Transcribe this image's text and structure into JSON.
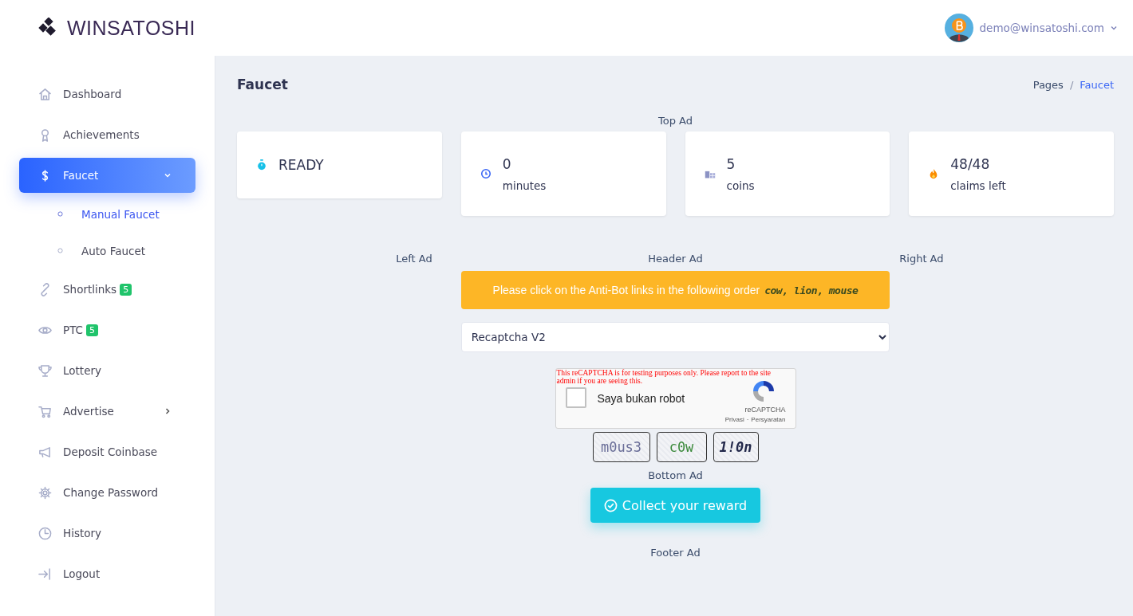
{
  "brand": {
    "name": "WINSATOSHI"
  },
  "user": {
    "email": "demo@winsatoshi.com"
  },
  "sidebar": {
    "items": [
      {
        "label": "Dashboard",
        "selected": false
      },
      {
        "label": "Achievements",
        "selected": false
      },
      {
        "label": "Faucet",
        "selected": true,
        "expanded": true,
        "children": [
          {
            "label": "Manual Faucet",
            "selected": true
          },
          {
            "label": "Auto Faucet",
            "selected": false
          }
        ]
      },
      {
        "label": "Shortlinks",
        "selected": false,
        "badge": "5"
      },
      {
        "label": "PTC",
        "selected": false,
        "badge": "5"
      },
      {
        "label": "Lottery",
        "selected": false
      },
      {
        "label": "Advertise",
        "selected": false,
        "expanded": false
      },
      {
        "label": "Deposit Coinbase",
        "selected": false
      },
      {
        "label": "Change Password",
        "selected": false
      },
      {
        "label": "History",
        "selected": false
      },
      {
        "label": "Logout",
        "selected": false
      }
    ]
  },
  "page": {
    "title": "Faucet",
    "breadcrumb_separator": "/",
    "breadcrumb": [
      {
        "label": "Pages",
        "selected": false
      },
      {
        "label": "Faucet",
        "selected": true
      }
    ]
  },
  "ads": {
    "top": "Top Ad",
    "left": "Left Ad",
    "header": "Header Ad",
    "right": "Right Ad",
    "bottom": "Bottom Ad",
    "footer": "Footer Ad"
  },
  "stats": [
    {
      "value": "READY"
    },
    {
      "value": "0",
      "caption": "minutes"
    },
    {
      "value": "5",
      "caption": "coins"
    },
    {
      "value": "48/48",
      "caption": "claims left"
    }
  ],
  "antibot": {
    "message": "Please click on the Anti-Bot links in the following order",
    "order": "cow, lion, mouse",
    "links": [
      "m0us3",
      "c0w",
      "1!0n"
    ]
  },
  "captcha_select": {
    "value": "Recaptcha V2"
  },
  "recaptcha": {
    "warning": "This reCAPTCHA is for testing purposes only. Please report to the site admin if you are seeing this.",
    "label": "Saya bukan robot",
    "checked": false,
    "brand": "reCAPTCHA",
    "privacy": "Privasi",
    "link_separator": "·",
    "terms": "Persyaratan"
  },
  "collect_button": {
    "label": "Collect your reward"
  }
}
